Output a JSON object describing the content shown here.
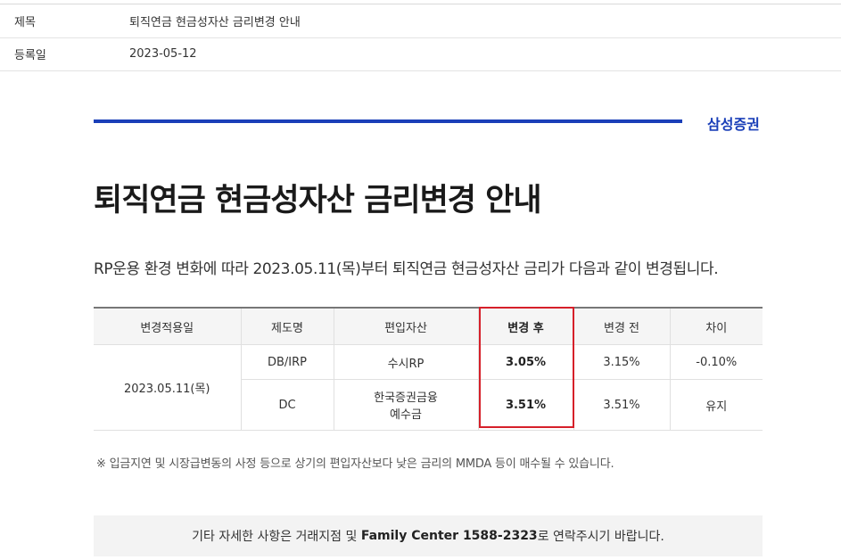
{
  "meta": {
    "subject_label": "제목",
    "subject_value": "퇴직연금 현금성자산 금리변경 안내",
    "date_label": "등록일",
    "date_value": "2023-05-12"
  },
  "brand": {
    "name": "삼성증권",
    "color": "#1a3fb8"
  },
  "notice": {
    "title": "퇴직연금 현금성자산 금리변경 안내",
    "intro": "RP운용 환경 변화에 따라 2023.05.11(목)부터 퇴직연금 현금성자산 금리가 다음과 같이 변경됩니다.",
    "table": {
      "headers": [
        "변경적용일",
        "제도명",
        "편입자산",
        "변경 후",
        "변경 전",
        "차이"
      ],
      "apply_date": "2023.05.11(목)",
      "rows": [
        {
          "plan": "DB/IRP",
          "asset": "수시RP",
          "after": "3.05%",
          "before": "3.15%",
          "diff": "-0.10%"
        },
        {
          "plan": "DC",
          "asset_line1": "한국증권금융",
          "asset_line2": "예수금",
          "after": "3.51%",
          "before": "3.51%",
          "diff": "유지"
        }
      ]
    },
    "note": "※ 입금지연 및 시장급변동의 사정 등으로 상기의 편입자산보다 낮은 금리의 MMDA 등이 매수될 수 있습니다.",
    "contact": {
      "prefix": "기타 자세한 사항은 거래지점 및 ",
      "highlight": "Family Center 1588-2323",
      "suffix": "로 연락주시기 바랍니다."
    }
  },
  "colors": {
    "highlight_border": "#d6202a"
  }
}
